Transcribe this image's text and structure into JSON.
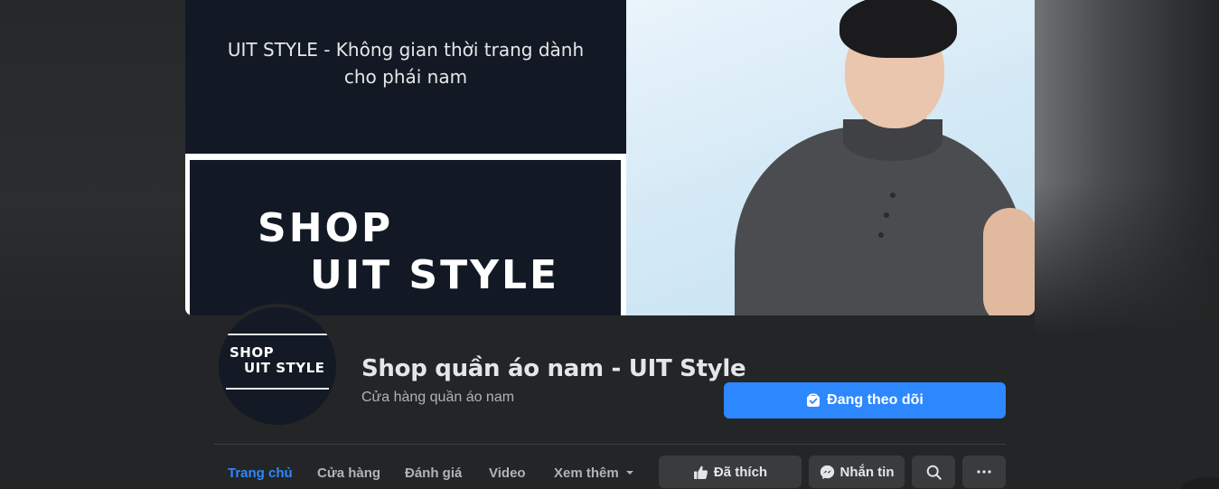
{
  "cover": {
    "tagline": "UIT STYLE - Không gian thời trang dành cho phái nam",
    "brand_line1": "SHOP",
    "brand_line2": "UIT STYLE"
  },
  "avatar": {
    "line1": "SHOP",
    "line2": "UIT STYLE"
  },
  "page": {
    "title": "Shop quần áo nam - UIT Style",
    "category": "Cửa hàng quần áo nam"
  },
  "follow_button": {
    "label": "Đang theo dõi",
    "icon": "follow-box-icon"
  },
  "tabs": [
    {
      "label": "Trang chủ",
      "active": true
    },
    {
      "label": "Cửa hàng",
      "active": false
    },
    {
      "label": "Đánh giá",
      "active": false
    },
    {
      "label": "Video",
      "active": false
    },
    {
      "label": "Xem thêm",
      "active": false,
      "icon": "caret-down-icon"
    }
  ],
  "actions": {
    "liked": {
      "label": "Đã thích",
      "icon": "thumbs-up-icon"
    },
    "message": {
      "label": "Nhắn tin",
      "icon": "messenger-icon"
    },
    "search": {
      "icon": "search-icon"
    },
    "more": {
      "icon": "more-dots-icon"
    }
  },
  "colors": {
    "background": "#242526",
    "accent": "#2d88ff",
    "button_bg": "#3a3b3c",
    "text_primary": "#e4e6eb",
    "text_secondary": "#b0b3b8"
  }
}
